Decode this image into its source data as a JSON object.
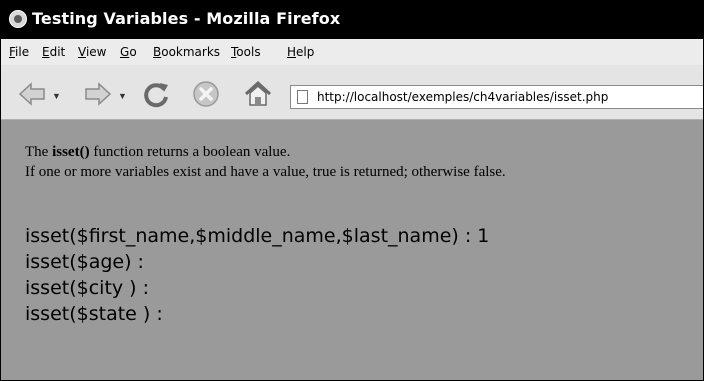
{
  "window": {
    "title": "Testing Variables - Mozilla Firefox",
    "icon": "firefox-logo-icon"
  },
  "menu": [
    {
      "label": "File",
      "accel": "F",
      "rest": "ile"
    },
    {
      "label": "Edit",
      "accel": "E",
      "rest": "dit"
    },
    {
      "label": "View",
      "accel": "V",
      "rest": "iew"
    },
    {
      "label": "Go",
      "accel": "G",
      "rest": "o"
    },
    {
      "label": "Bookmarks",
      "accel": "B",
      "rest": "ookmarks"
    },
    {
      "label": "Tools",
      "accel": "T",
      "rest": "ools"
    },
    {
      "label": "Help",
      "accel": "H",
      "rest": "elp"
    }
  ],
  "toolbar": {
    "icons": [
      "back-icon",
      "forward-icon",
      "reload-icon",
      "stop-icon",
      "home-icon"
    ],
    "url": "http://localhost/exemples/ch4variables/isset.php"
  },
  "content": {
    "line1_pre": "The ",
    "line1_bold": "isset()",
    "line1_post": " function returns a boolean value.",
    "line2": "If one or more variables exist and have a value, true is returned; otherwise false.",
    "results": [
      "isset($first_name,$middle_name,$last_name) : 1",
      "isset($age) :",
      "isset($city ) :",
      "isset($state ) :"
    ]
  }
}
